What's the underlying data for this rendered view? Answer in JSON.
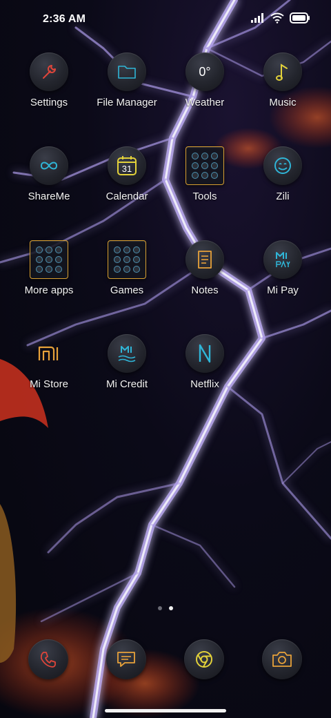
{
  "status_bar": {
    "time": "2:36 AM",
    "icons": [
      "signal-icon",
      "wifi-icon",
      "battery-icon"
    ]
  },
  "apps": [
    {
      "label": "Settings",
      "icon": "wrench-icon"
    },
    {
      "label": "File Manager",
      "icon": "folder-icon"
    },
    {
      "label": "Weather",
      "icon": "weather-icon",
      "value": "0°"
    },
    {
      "label": "Music",
      "icon": "music-note-icon"
    },
    {
      "label": "ShareMe",
      "icon": "infinity-icon"
    },
    {
      "label": "Calendar",
      "icon": "calendar-icon",
      "value": "31"
    },
    {
      "label": "Tools",
      "icon": "folder-grid-icon"
    },
    {
      "label": "Zili",
      "icon": "smiley-icon"
    },
    {
      "label": "More apps",
      "icon": "folder-grid-icon"
    },
    {
      "label": "Games",
      "icon": "folder-grid-icon"
    },
    {
      "label": "Notes",
      "icon": "notes-icon"
    },
    {
      "label": "Mi Pay",
      "icon": "mi-pay-icon"
    },
    {
      "label": "Mi Store",
      "icon": "mi-store-icon"
    },
    {
      "label": "Mi Credit",
      "icon": "mi-credit-icon"
    },
    {
      "label": "Netflix",
      "icon": "netflix-icon"
    }
  ],
  "page_indicator": {
    "total": 2,
    "active": 2
  },
  "dock": [
    {
      "icon": "phone-icon"
    },
    {
      "icon": "messages-icon"
    },
    {
      "icon": "chrome-icon"
    },
    {
      "icon": "camera-icon"
    }
  ],
  "colors": {
    "accent_orange": "#e8a23a",
    "accent_cyan": "#2fb6d8",
    "accent_red": "#e0453a",
    "accent_yellow": "#e3d23a",
    "lightning": "#b7a6e8"
  }
}
